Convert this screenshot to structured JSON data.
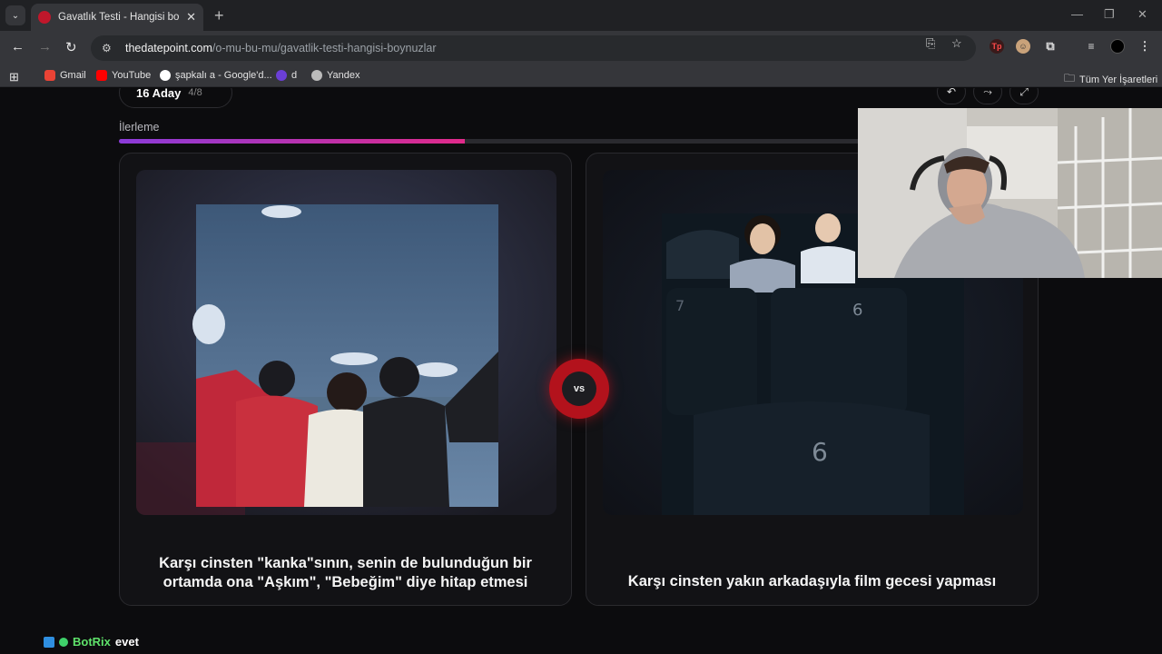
{
  "browser": {
    "tab_title": "Gavatlık Testi - Hangisi boynuzlar",
    "url_host": "thedatepoint.com",
    "url_path": "/o-mu-bu-mu/gavatlik-testi-hangisi-boynuzlar",
    "bookmarks": [
      "Gmail",
      "YouTube",
      "şapkalı a - Google'd...",
      "d",
      "Yandex"
    ],
    "bookmarks_folder": "Tüm Yer İşaretleri"
  },
  "page": {
    "count_main": "16 Aday",
    "count_sub": "4/8",
    "progress_label": "İlerleme",
    "progress_fraction": 0.377,
    "vs_label": "vs"
  },
  "options": [
    {
      "caption": "Karşı cinsten \"kanka\"sının, senin de bulunduğun bir ortamda ona \"Aşkım\", \"Bebeğim\" diye hitap etmesi"
    },
    {
      "caption": "Karşı cinsten yakın arkadaşıyla film gecesi yapması"
    }
  ],
  "chat": {
    "bot_name": "BotRix",
    "message": "evet"
  },
  "colors": {
    "accent_start": "#8b3bd9",
    "accent_end": "#e02a8a",
    "vs_red": "#b3121c"
  }
}
